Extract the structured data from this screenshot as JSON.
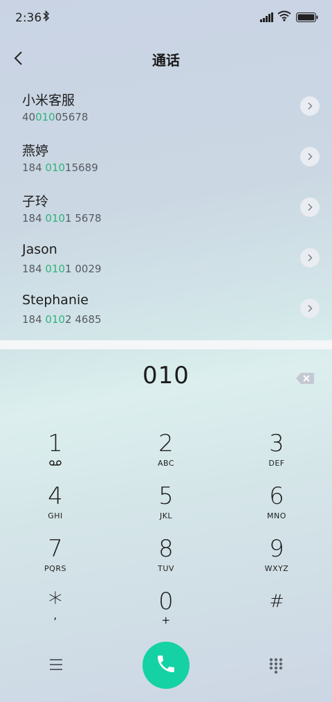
{
  "status_bar": {
    "time": "2:36",
    "icons": [
      "bluetooth-icon",
      "signal-icon",
      "wifi-icon",
      "battery-icon"
    ]
  },
  "header": {
    "title": "通话",
    "back_icon": "back-chevron-icon"
  },
  "results": [
    {
      "name": "小米客服",
      "num_pre": "40",
      "num_hl": "010",
      "num_post": "05678"
    },
    {
      "name": "燕婷",
      "num_pre": "184 ",
      "num_hl": "010",
      "num_post": "15689"
    },
    {
      "name": "子玲",
      "num_pre": "184 ",
      "num_hl": "010",
      "num_post": "1 5678"
    },
    {
      "name": "Jason",
      "num_pre": "184 ",
      "num_hl": "010",
      "num_post": "1 0029"
    },
    {
      "name": "Stephanie",
      "num_pre": "184 ",
      "num_hl": "010",
      "num_post": "2 4685"
    }
  ],
  "dialer": {
    "input": "010",
    "keys": [
      {
        "digit": "1",
        "letters": ""
      },
      {
        "digit": "2",
        "letters": "ABC"
      },
      {
        "digit": "3",
        "letters": "DEF"
      },
      {
        "digit": "4",
        "letters": "GHI"
      },
      {
        "digit": "5",
        "letters": "JKL"
      },
      {
        "digit": "6",
        "letters": "MNO"
      },
      {
        "digit": "7",
        "letters": "PQRS"
      },
      {
        "digit": "8",
        "letters": "TUV"
      },
      {
        "digit": "9",
        "letters": "WXYZ"
      },
      {
        "digit": "*",
        "letters": ","
      },
      {
        "digit": "0",
        "letters": "+"
      },
      {
        "digit": "#",
        "letters": ""
      }
    ]
  },
  "colors": {
    "accent_green": "#2fb37c",
    "call_button": "#14d2a4"
  }
}
